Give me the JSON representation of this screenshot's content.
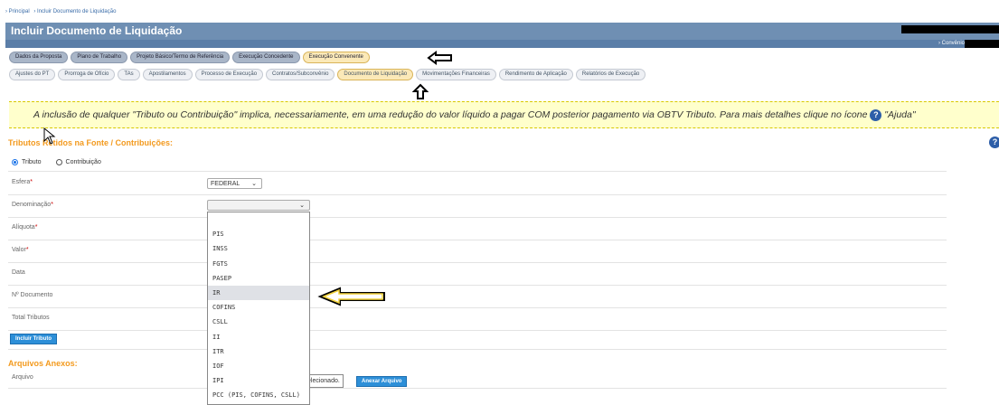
{
  "breadcrumb": [
    "› Principal",
    "› Incluir Documento de Liquidação"
  ],
  "page_title": "Incluir Documento de Liquidação",
  "header_right": "› Convênio",
  "tabs_row1": [
    "Dados da Proposta",
    "Plano de Trabalho",
    "Projeto Básico/Termo de Referência",
    "Execução Concedente",
    "Execução Convenente"
  ],
  "tabs_row2": [
    "Ajustes do PT",
    "Prorroga de Ofício",
    "TAs",
    "Apostilamentos",
    "Processo de Execução",
    "Contratos/Subconvênio",
    "Documento de Liquidação",
    "Movimentações Financeiras",
    "Rendimento de Aplicação",
    "Relatórios de Execução"
  ],
  "notice": {
    "text": "A inclusão de qualquer \"Tributo ou Contribuição\" implica, necessariamente, em uma redução do valor líquido a pagar COM posterior pagamento via OBTV Tributo. Para mais detalhes clique no ícone",
    "after": "\"Ajuda\""
  },
  "section_tributos": "Tributos Retidos na Fonte / Contribuições:",
  "radio": {
    "tributo": "Tributo",
    "contribuicao": "Contribuição"
  },
  "fields": {
    "esfera": "Esfera",
    "denominacao": "Denominação",
    "aliquota": "Alíquota",
    "valor": "Valor",
    "data": "Data",
    "documento": "Nº Documento",
    "total": "Total Tributos"
  },
  "esfera_value": "FEDERAL",
  "options": [
    "PIS",
    "INSS",
    "FGTS",
    "PASEP",
    "IR",
    "COFINS",
    "CSLL",
    "II",
    "ITR",
    "IOF",
    "IPI",
    "PCC (PIS, COFINS, CSLL)"
  ],
  "incluir_tributo": "Incluir Tributo",
  "section_anexos": "Arquivos Anexos:",
  "arquivo_label": "Arquivo",
  "arquivo_text": "elecionado.",
  "anexar_button": "Anexar Arquivo"
}
